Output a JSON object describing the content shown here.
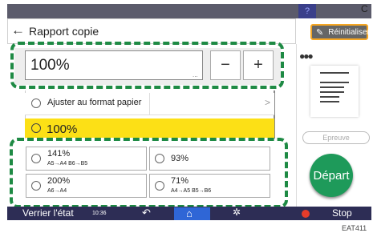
{
  "header": {
    "title": "Rapport copie",
    "reset_label": "Réinitialiser"
  },
  "topbar": {
    "help_icon": "question-icon",
    "corner_text": "C"
  },
  "ratio": {
    "value": "100%",
    "dots": "...",
    "minus": "−",
    "plus": "+"
  },
  "options": {
    "fit_label": "Ajuster au format papier",
    "selected_label": "100%"
  },
  "presets": [
    {
      "main": "141%",
      "sub": "A5→A4  B6→B5"
    },
    {
      "main": "93%",
      "sub": ""
    },
    {
      "main": "200%",
      "sub": "A6→A4"
    },
    {
      "main": "71%",
      "sub": "A4→A5  B5→B6"
    }
  ],
  "side": {
    "epreuve": "Epreuve",
    "depart": "Départ"
  },
  "bottom": {
    "left_text": "Verrier l'état",
    "time": "10:36",
    "stop": "Stop"
  },
  "caption": "EAT411"
}
